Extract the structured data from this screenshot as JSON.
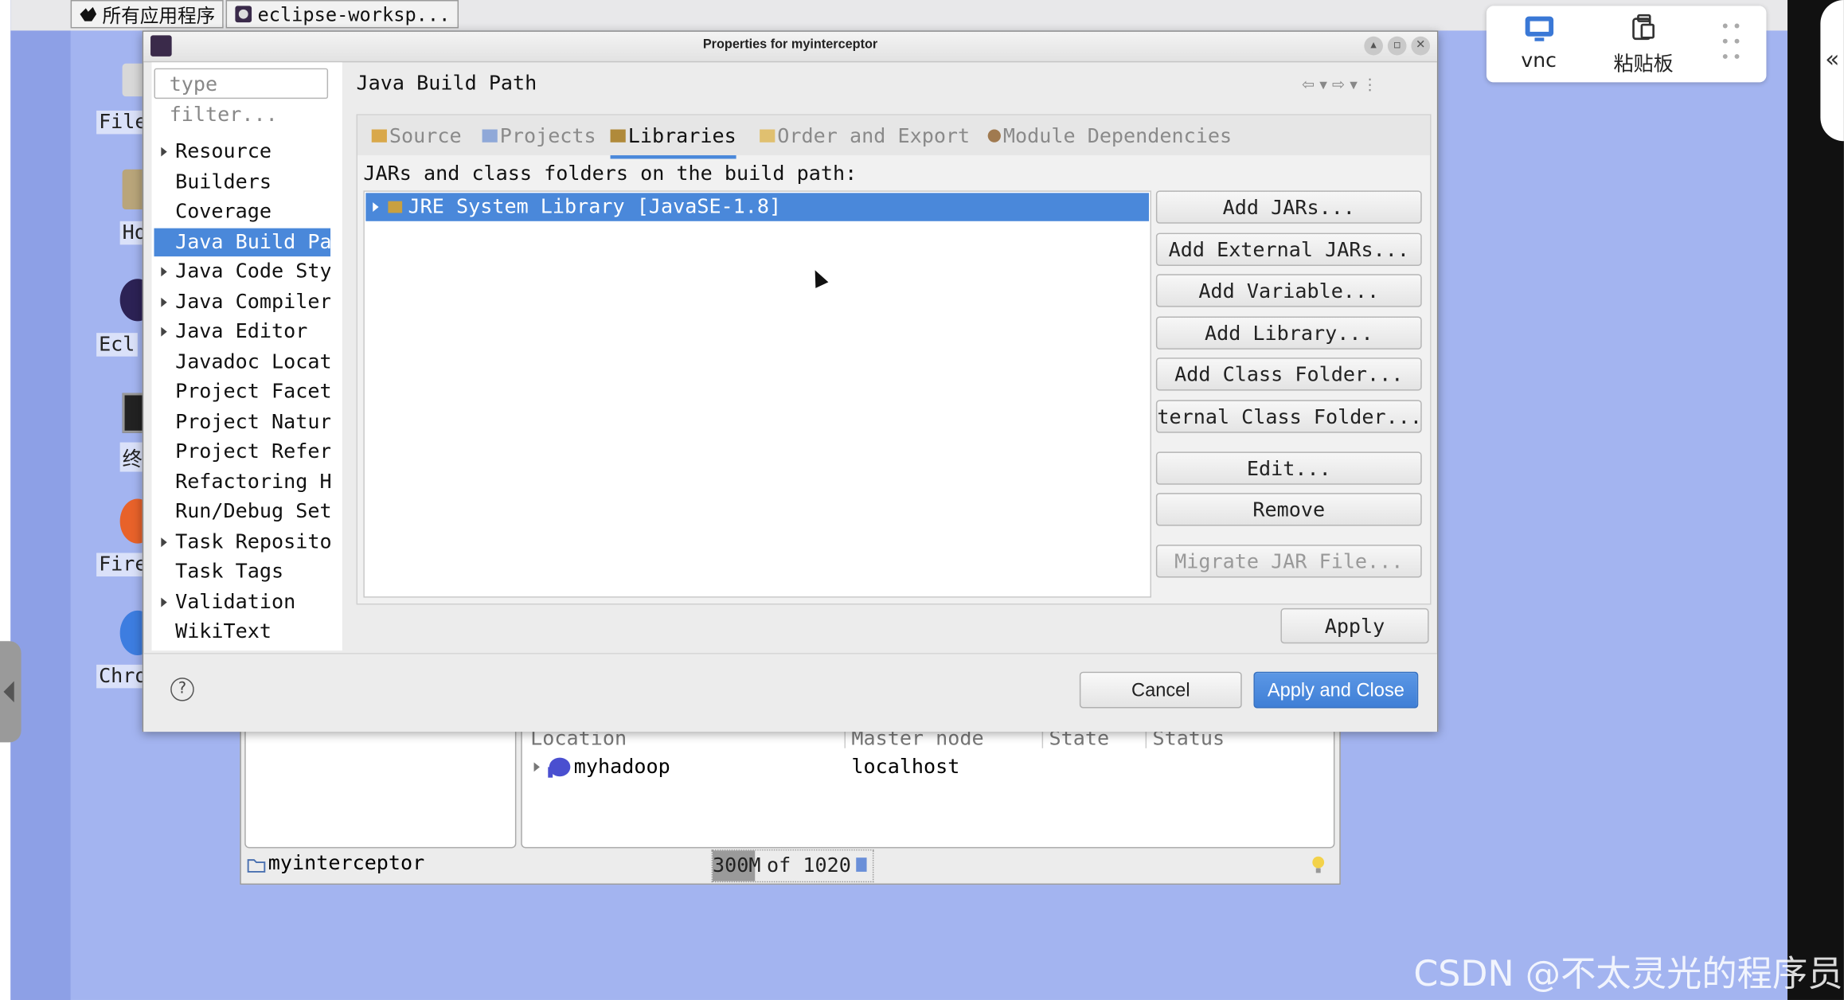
{
  "taskbar": {
    "apps_label": "所有应用程序",
    "window_label": "eclipse-worksp..."
  },
  "desktop_icons": [
    {
      "label": "File"
    },
    {
      "label": "Ho"
    },
    {
      "label": "Ecl"
    },
    {
      "label": "终"
    },
    {
      "label": "Fire"
    },
    {
      "label": "Chro"
    }
  ],
  "vnc_toolbar": {
    "vnc_label": "vnc",
    "clipboard_label": "粘贴板"
  },
  "dialog": {
    "title": "Properties for myinterceptor",
    "filter_placeholder": "type filter...",
    "nav_items": [
      {
        "label": "Resource",
        "expandable": true
      },
      {
        "label": "Builders",
        "expandable": false
      },
      {
        "label": "Coverage",
        "expandable": false
      },
      {
        "label": "Java Build Pa",
        "expandable": false,
        "selected": true
      },
      {
        "label": "Java Code Sty",
        "expandable": true
      },
      {
        "label": "Java Compiler",
        "expandable": true
      },
      {
        "label": "Java Editor",
        "expandable": true
      },
      {
        "label": "Javadoc Locat",
        "expandable": false
      },
      {
        "label": "Project Facet",
        "expandable": false
      },
      {
        "label": "Project Natur",
        "expandable": false
      },
      {
        "label": "Project Refer",
        "expandable": false
      },
      {
        "label": "Refactoring H",
        "expandable": false
      },
      {
        "label": "Run/Debug Set",
        "expandable": false
      },
      {
        "label": "Task Reposito",
        "expandable": true
      },
      {
        "label": "Task Tags",
        "expandable": false
      },
      {
        "label": "Validation",
        "expandable": true
      },
      {
        "label": "WikiText",
        "expandable": false
      }
    ],
    "page_title": "Java Build Path",
    "tabs": [
      {
        "label": "Source"
      },
      {
        "label": "Projects"
      },
      {
        "label": "Libraries",
        "active": true
      },
      {
        "label": "Order and Export"
      },
      {
        "label": "Module Dependencies"
      }
    ],
    "jars_label": "JARs and class folders on the build path:",
    "library_entry": "JRE System Library [JavaSE-1.8]",
    "side_buttons": [
      {
        "label": "Add JARs...",
        "enabled": true
      },
      {
        "label": "Add External JARs...",
        "enabled": true
      },
      {
        "label": "Add Variable...",
        "enabled": true
      },
      {
        "label": "Add Library...",
        "enabled": true
      },
      {
        "label": "Add Class Folder...",
        "enabled": true
      },
      {
        "label": "ternal Class Folder...",
        "enabled": true
      },
      {
        "label": "Edit...",
        "enabled": true
      },
      {
        "label": "Remove",
        "enabled": true
      },
      {
        "label": "Migrate JAR File...",
        "enabled": false
      }
    ],
    "apply_label": "Apply",
    "help_label": "?",
    "cancel_label": "Cancel",
    "apply_close_label": "Apply and Close"
  },
  "background_window": {
    "columns": [
      "Location",
      "Master node",
      "State",
      "Status"
    ],
    "row": {
      "location": "myhadoop",
      "master_node": "localhost"
    },
    "project_label": "myinterceptor",
    "heap_used": "300M",
    "heap_of": "of 1020"
  },
  "watermark": "CSDN @不太灵光的程序员",
  "colors": {
    "selection": "#4a88da",
    "desktop": "#a3b4f0",
    "dialog_bg": "#ececec"
  }
}
